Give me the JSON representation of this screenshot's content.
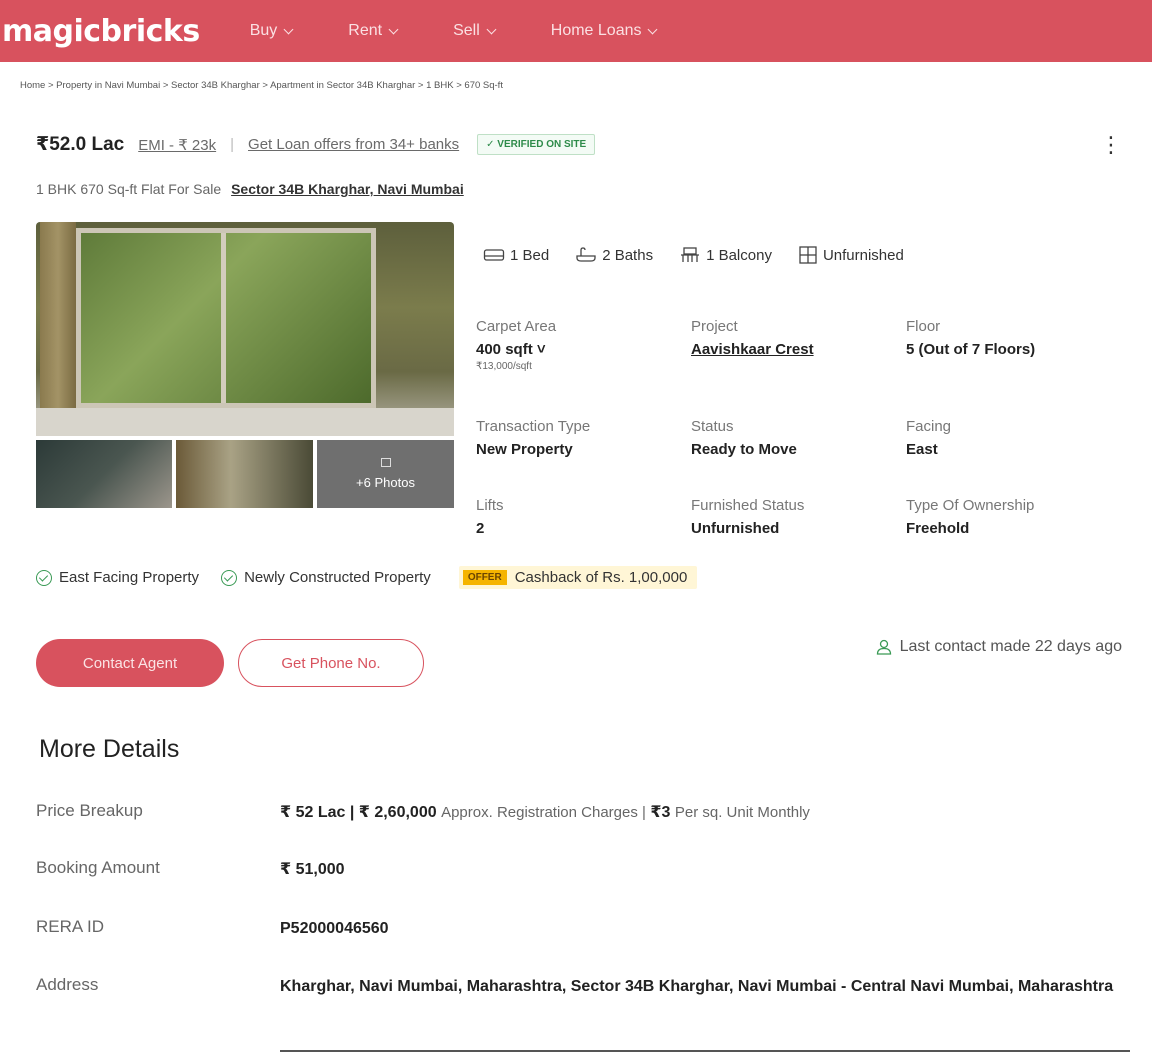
{
  "header": {
    "logo": "magicbricks",
    "nav": [
      "Buy",
      "Rent",
      "Sell",
      "Home Loans"
    ]
  },
  "breadcrumb": [
    "Home",
    "Property in Navi Mumbai",
    "Sector 34B Kharghar",
    "Apartment in Sector 34B Kharghar",
    "1 BHK",
    "670 Sq-ft"
  ],
  "listing": {
    "price": "₹52.0 Lac",
    "emi": "EMI - ₹ 23k",
    "loan_offers": "Get Loan offers from 34+ banks",
    "verified_badge": "✓ VERIFIED ON SITE",
    "title": "1 BHK 670 Sq-ft Flat For Sale",
    "location": "Sector 34B Kharghar, Navi Mumbai",
    "more_photos": "+6 Photos"
  },
  "amenities": [
    {
      "label": "1 Bed",
      "icon": "bed-icon"
    },
    {
      "label": "2 Baths",
      "icon": "bath-icon"
    },
    {
      "label": "1 Balcony",
      "icon": "balcony-icon"
    },
    {
      "label": "Unfurnished",
      "icon": "furnish-icon"
    }
  ],
  "specs": {
    "carpet_area": {
      "label": "Carpet Area",
      "value": "400 sqft ˅",
      "sub": "₹13,000/sqft"
    },
    "project": {
      "label": "Project",
      "value": "Aavishkaar Crest"
    },
    "floor": {
      "label": "Floor",
      "value": "5 (Out of 7 Floors)"
    },
    "transaction": {
      "label": "Transaction Type",
      "value": "New Property"
    },
    "status": {
      "label": "Status",
      "value": "Ready to Move"
    },
    "facing": {
      "label": "Facing",
      "value": "East"
    },
    "lifts": {
      "label": "Lifts",
      "value": "2"
    },
    "furnished": {
      "label": "Furnished Status",
      "value": "Unfurnished"
    },
    "ownership": {
      "label": "Type Of Ownership",
      "value": "Freehold"
    }
  },
  "highlights": {
    "items": [
      "East Facing Property",
      "Newly Constructed Property"
    ],
    "offer_tag": "OFFER",
    "offer_text": "Cashback of Rs. 1,00,000"
  },
  "actions": {
    "contact": "Contact Agent",
    "phone": "Get Phone No.",
    "last_contact": "Last contact made 22 days ago"
  },
  "more_details": {
    "title": "More Details",
    "price_breakup": {
      "label": "Price Breakup",
      "v1": "₹ 52 Lac | ₹ 2,60,000",
      "v1_note": "Approx. Registration Charges |",
      "v2": "₹3",
      "v2_note": "Per sq. Unit Monthly"
    },
    "booking": {
      "label": "Booking Amount",
      "value": "₹ 51,000"
    },
    "rera": {
      "label": "RERA ID",
      "value": "P52000046560"
    },
    "address": {
      "label": "Address",
      "value": "Kharghar, Navi Mumbai, Maharashtra, Sector 34B Kharghar, Navi Mumbai - Central Navi Mumbai, Maharashtra"
    }
  },
  "colors": {
    "brand": "#d8525e",
    "verified": "#2e8b4a",
    "offer": "#f5b400"
  }
}
